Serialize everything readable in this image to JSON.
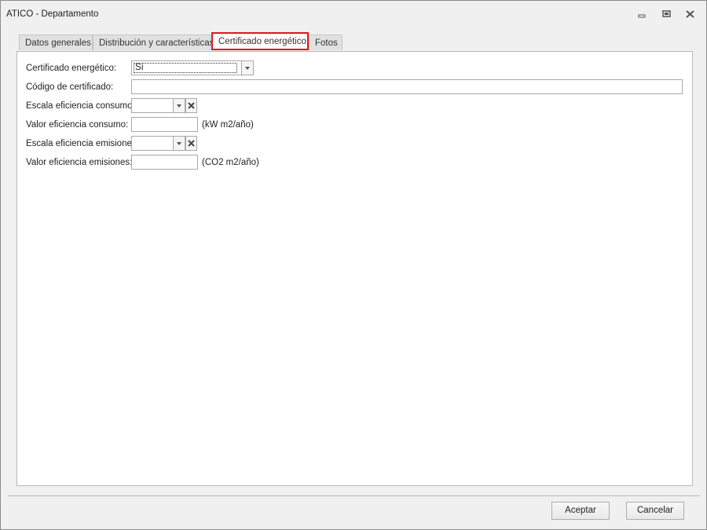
{
  "window": {
    "title": "ATICO - Departamento"
  },
  "titlebar_icons": {
    "minimize": "minimize-icon",
    "maximize": "maximize-icon",
    "close": "close-icon"
  },
  "tabs": [
    {
      "label": "Datos generales",
      "active": false
    },
    {
      "label": "Distribución y características",
      "active": false
    },
    {
      "label": "Certificado energético",
      "active": true
    },
    {
      "label": "Fotos",
      "active": false
    }
  ],
  "form": {
    "certificado_label": "Certificado energético:",
    "certificado_value": "Sí",
    "codigo_label": "Código de certificado:",
    "codigo_value": "",
    "escala_consumo_label": "Escala eficiencia consumo:",
    "escala_consumo_value": "",
    "valor_consumo_label": "Valor eficiencia consumo:",
    "valor_consumo_value": "",
    "valor_consumo_unit": "(kW m2/año)",
    "escala_emisiones_label": "Escala eficiencia emisiones:",
    "escala_emisiones_value": "",
    "valor_emisiones_label": "Valor eficiencia emisiones:",
    "valor_emisiones_value": "",
    "valor_emisiones_unit": "(CO2 m2/año)"
  },
  "footer": {
    "accept_label": "Aceptar",
    "cancel_label": "Cancelar"
  },
  "colors": {
    "active_tab_border": "#e0161e",
    "window_bg": "#f0f0f0"
  }
}
